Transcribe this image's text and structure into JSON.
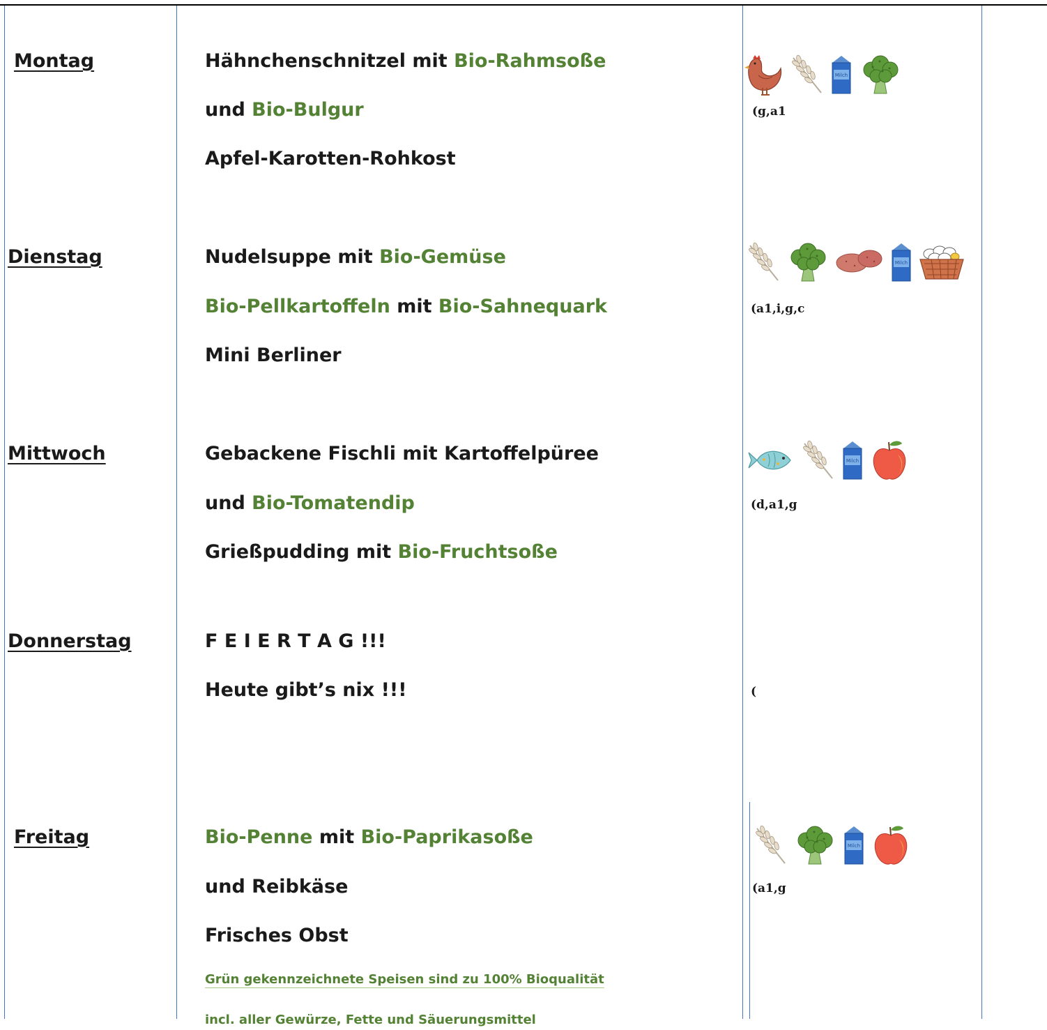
{
  "days": [
    {
      "name": "Montag",
      "lines": [
        [
          {
            "t": "Hähnchenschnitzel mit ",
            "bio": false
          },
          {
            "t": "Bio-Rahmsoße",
            "bio": true
          }
        ],
        [
          {
            "t": "und ",
            "bio": false
          },
          {
            "t": "Bio-Bulgur",
            "bio": true
          }
        ],
        [
          {
            "t": "Apfel-Karotten-Rohkost",
            "bio": false
          }
        ]
      ],
      "icons": [
        "chicken-icon",
        "wheat-icon",
        "milk-carton-icon",
        "broccoli-icon"
      ],
      "allergens": "(g,a1"
    },
    {
      "name": "Dienstag",
      "lines": [
        [
          {
            "t": "Nudelsuppe mit ",
            "bio": false
          },
          {
            "t": "Bio-Gemüse",
            "bio": true
          }
        ],
        [
          {
            "t": "Bio-Pellkartoffeln",
            "bio": true
          },
          {
            "t": " mit ",
            "bio": false
          },
          {
            "t": "Bio-Sahnequark",
            "bio": true
          }
        ],
        [
          {
            "t": "Mini Berliner",
            "bio": false
          }
        ]
      ],
      "icons": [
        "wheat-icon",
        "broccoli-icon",
        "potato-icon",
        "milk-carton-icon",
        "egg-basket-icon"
      ],
      "allergens": "(a1,i,g,c"
    },
    {
      "name": "Mittwoch",
      "lines": [
        [
          {
            "t": "Gebackene Fischli mit Kartoffelpüree",
            "bio": false
          }
        ],
        [
          {
            "t": "und ",
            "bio": false
          },
          {
            "t": "Bio-Tomatendip",
            "bio": true
          }
        ],
        [
          {
            "t": "Grießpudding mit ",
            "bio": false
          },
          {
            "t": "Bio-Fruchtsoße",
            "bio": true
          }
        ]
      ],
      "icons": [
        "fish-icon",
        "wheat-icon",
        "milk-carton-icon",
        "apple-icon"
      ],
      "allergens": "(d,a1,g"
    },
    {
      "name": "Donnerstag",
      "lines": [
        [
          {
            "t": "F E I E R T A G !!!",
            "bio": false
          }
        ],
        [
          {
            "t": "Heute gibt’s nix !!!",
            "bio": false
          }
        ]
      ],
      "icons": [],
      "allergens": "("
    },
    {
      "name": "Freitag",
      "lines": [
        [
          {
            "t": "Bio-Penne",
            "bio": true
          },
          {
            "t": " mit ",
            "bio": false
          },
          {
            "t": "Bio-Paprikasoße",
            "bio": true
          }
        ],
        [
          {
            "t": "und Reibkäse",
            "bio": false
          }
        ],
        [
          {
            "t": "Frisches Obst",
            "bio": false
          }
        ]
      ],
      "icons": [
        "wheat-icon",
        "broccoli-icon",
        "milk-carton-icon",
        "apple-icon"
      ],
      "allergens": "(a1,g"
    }
  ],
  "icon_label_milk": "Milch",
  "notes": {
    "line1": "Grün gekennzeichnete Speisen sind zu 100% Bioqualität",
    "line2": "incl. aller Gewürze, Fette und Säuerungsmittel"
  },
  "colors": {
    "bio": "#548235",
    "rule": "#4472c4"
  }
}
